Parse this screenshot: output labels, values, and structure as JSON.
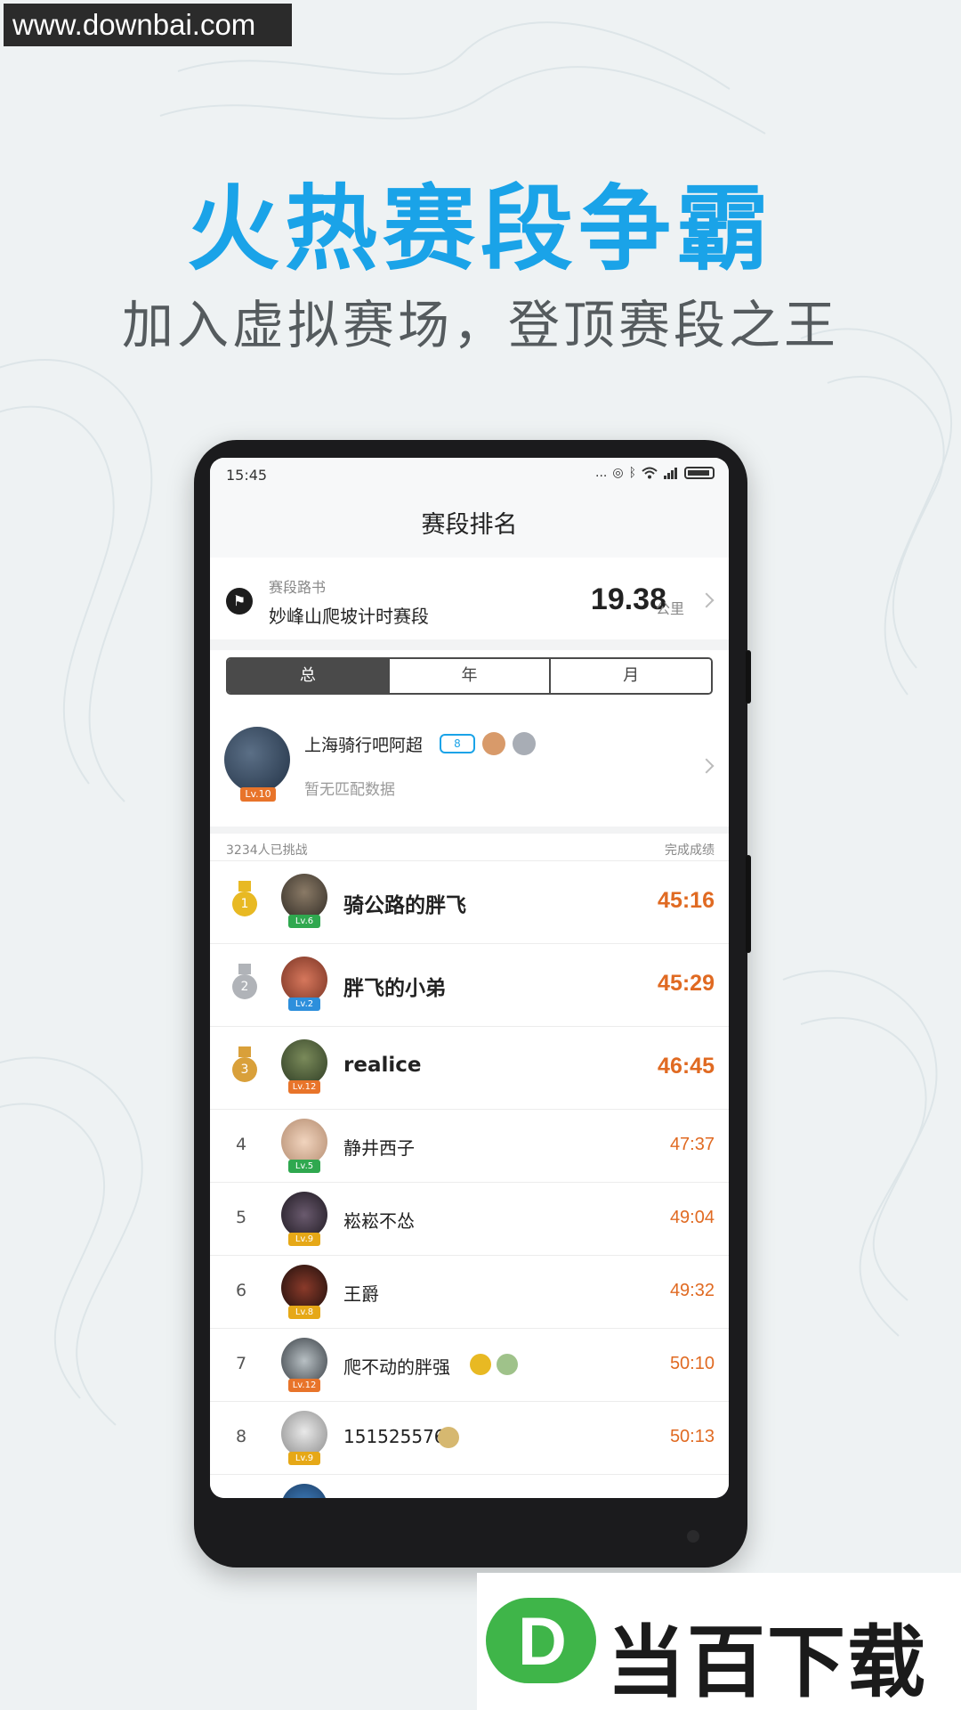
{
  "watermark": "www.downbai.com",
  "promo": {
    "title": "火热赛段争霸",
    "subtitle": "加入虚拟赛场，登顶赛段之王"
  },
  "status_bar": {
    "time": "15:45",
    "dots": "...",
    "icons": [
      "alarm-icon",
      "bluetooth-icon",
      "wifi-icon",
      "signal-icon",
      "battery-icon"
    ]
  },
  "nav": {
    "title": "赛段排名"
  },
  "route": {
    "caption": "赛段路书",
    "name": "妙峰山爬坡计时赛段",
    "distance": "19.38",
    "unit": "公里"
  },
  "tabs": [
    {
      "label": "总",
      "active": true
    },
    {
      "label": "年",
      "active": false
    },
    {
      "label": "月",
      "active": false
    }
  ],
  "current_user": {
    "name": "上海骑行吧阿超",
    "level": "Lv.10",
    "badge_number": "8",
    "status": "暂无匹配数据"
  },
  "list_header": {
    "participants": "3234人已挑战",
    "result_label": "完成成绩"
  },
  "leaderboard": [
    {
      "rank": "1",
      "name": "骑公路的胖飞",
      "level": "Lv.6",
      "time": "45:16"
    },
    {
      "rank": "2",
      "name": "胖飞的小弟",
      "level": "Lv.2",
      "time": "45:29"
    },
    {
      "rank": "3",
      "name": "realice",
      "level": "Lv.12",
      "time": "46:45"
    },
    {
      "rank": "4",
      "name": "静井西子",
      "level": "Lv.5",
      "time": "47:37"
    },
    {
      "rank": "5",
      "name": "崧崧不怂",
      "level": "Lv.9",
      "time": "49:04"
    },
    {
      "rank": "6",
      "name": "王爵",
      "level": "Lv.8",
      "time": "49:32"
    },
    {
      "rank": "7",
      "name": "爬不动的胖强",
      "level": "Lv.12",
      "time": "50:10"
    },
    {
      "rank": "8",
      "name": "151525576",
      "level": "Lv.9",
      "time": "50:13"
    }
  ],
  "brand": {
    "logo_letter": "D",
    "name": "当百下载"
  },
  "colors": {
    "accent_blue": "#1aa3e8",
    "time_orange": "#e06a22",
    "gold": "#e8b923",
    "silver": "#b0b3b8",
    "bronze": "#d9a03a",
    "level_green": "#2fa84f",
    "level_blue": "#2d8fdc",
    "level_orange": "#e8742a",
    "level_yellow": "#e6a817",
    "brand_green": "#3fb549"
  }
}
